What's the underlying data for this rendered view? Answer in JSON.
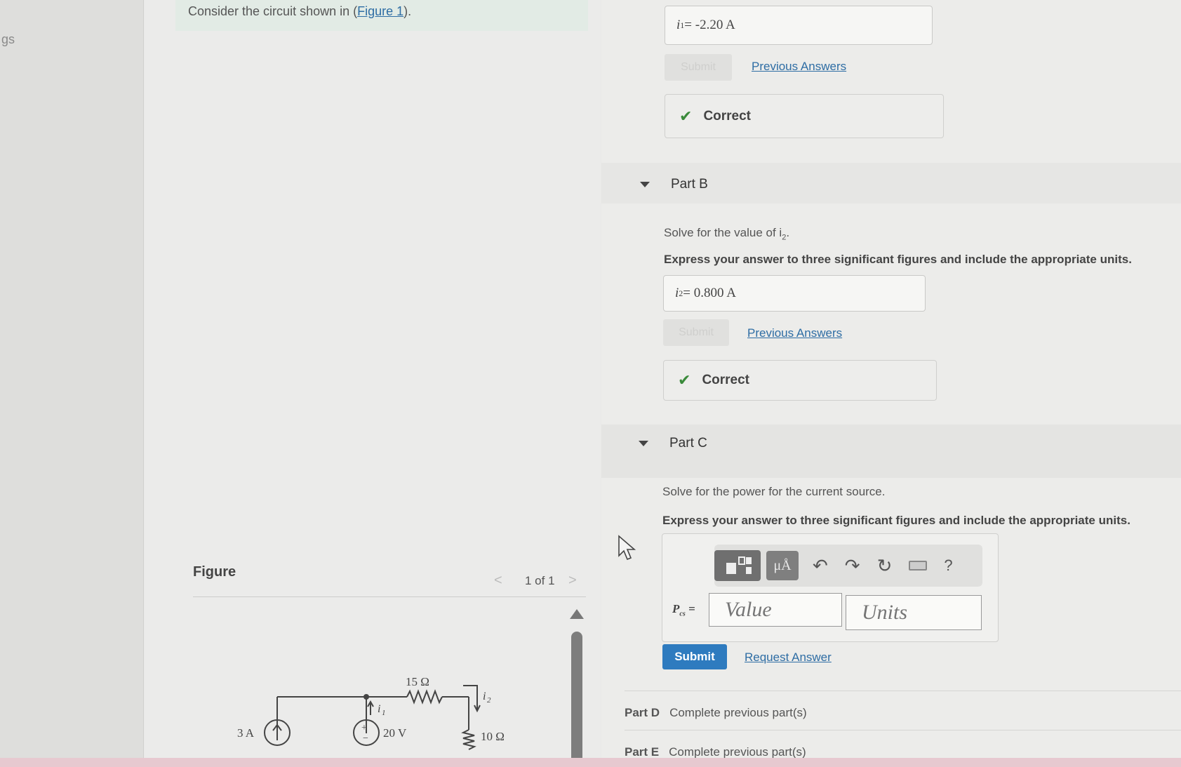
{
  "sidebar": {
    "fragment_text": "gs"
  },
  "intro": {
    "prefix": "Consider the circuit shown in (",
    "link": "Figure 1",
    "suffix": ")."
  },
  "figure": {
    "label": "Figure",
    "pager": {
      "prev": "<",
      "text": "1 of 1",
      "next": ">"
    },
    "circuit": {
      "current_source": "3 A",
      "voltage_source": "20 V",
      "resistor_top": "15 Ω",
      "resistor_right": "10 Ω",
      "i1_label": "i",
      "i1_sub": "1",
      "i2_label": "i",
      "i2_sub": "2"
    }
  },
  "part_a": {
    "answer_var": "i",
    "answer_sub": "1",
    "answer_value": " = -2.20 A",
    "submit": "Submit",
    "previous_answers": "Previous Answers",
    "correct": "Correct"
  },
  "part_b": {
    "title": "Part B",
    "question": "Solve for the value of i",
    "question_sub": "2",
    "question_end": ".",
    "instruction": "Express your answer to three significant figures and include the appropriate units.",
    "answer_var": "i",
    "answer_sub": "2",
    "answer_value": " = 0.800 A",
    "submit": "Submit",
    "previous_answers": "Previous Answers",
    "correct": "Correct"
  },
  "part_c": {
    "title": "Part C",
    "question": "Solve for the power for the current source.",
    "instruction": "Express your answer to three significant figures and include the appropriate units.",
    "toolbar": {
      "units_btn": "μÅ",
      "help": "?"
    },
    "var_label": "P",
    "var_sub": "cs",
    "var_eq": " =",
    "value_placeholder": "Value",
    "units_placeholder": "Units",
    "submit": "Submit",
    "request_answer": "Request Answer"
  },
  "part_d": {
    "label": "Part D",
    "status": "Complete previous part(s)"
  },
  "part_e": {
    "label": "Part E",
    "status": "Complete previous part(s)"
  },
  "colors": {
    "accent": "#2e7bbf",
    "link": "#2e6da4",
    "correct_check": "#3a8a3a"
  }
}
